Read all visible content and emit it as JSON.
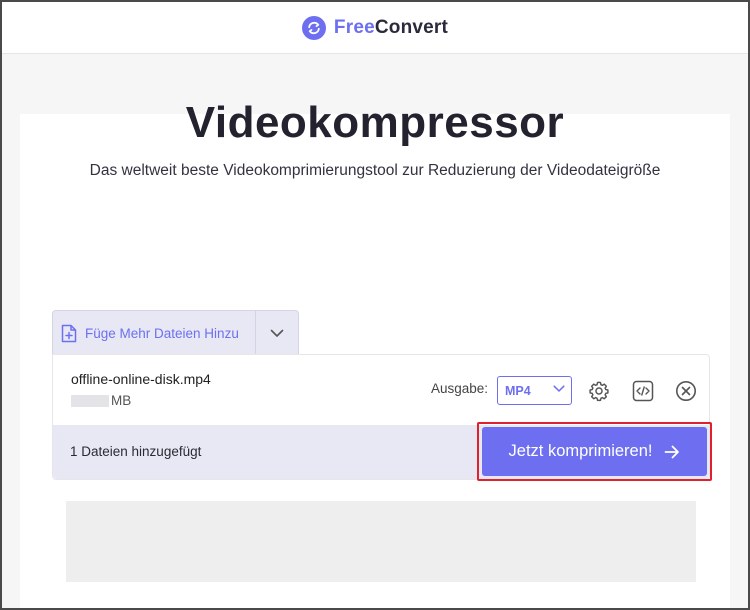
{
  "brand": {
    "part1": "Free",
    "part2": "Convert"
  },
  "page": {
    "title": "Videokompressor",
    "subtitle": "Das weltweit beste Videokomprimierungstool zur Reduzierung der Videodateigröße"
  },
  "uploader": {
    "add_files_label": "Füge Mehr Dateien Hinzu",
    "file": {
      "name": "offline-online-disk.mp4",
      "size_unit": "MB"
    },
    "output_label": "Ausgabe:",
    "output_format": "MP4",
    "files_added": "1 Dateien hinzugefügt",
    "compress_label": "Jetzt komprimieren!"
  },
  "icons": {
    "logo": "sync-logo-icon",
    "add_file": "file-plus-icon",
    "dropdown": "chevron-down-icon",
    "settings": "gear-icon",
    "embed": "code-icon",
    "remove": "close-circle-icon",
    "arrow": "arrow-right-icon"
  },
  "colors": {
    "accent": "#6d6ff0",
    "highlight": "#e0202a",
    "panel": "#e7e8f4"
  }
}
